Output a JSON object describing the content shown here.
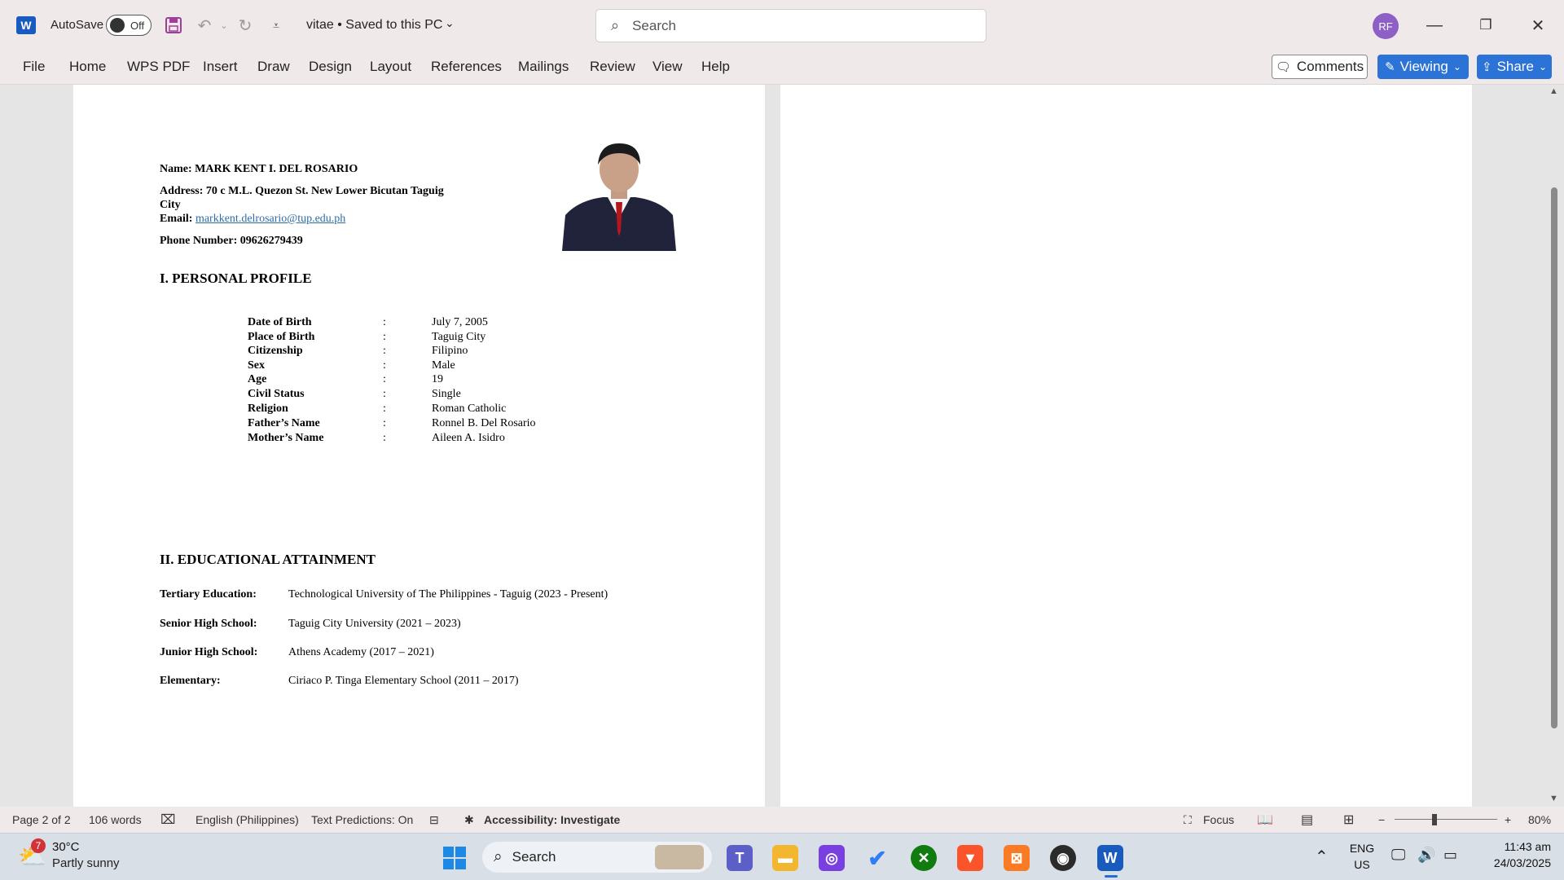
{
  "titlebar": {
    "app_logo": "W",
    "autosave_label": "AutoSave",
    "autosave_state": "Off",
    "document_title": "vitae • Saved to this PC",
    "search_placeholder": "Search",
    "avatar_initials": "RF"
  },
  "ribbon": {
    "tabs": [
      "File",
      "Home",
      "WPS PDF",
      "Insert",
      "Draw",
      "Design",
      "Layout",
      "References",
      "Mailings",
      "Review",
      "View",
      "Help"
    ],
    "comments_label": "Comments",
    "viewing_label": "Viewing",
    "share_label": "Share"
  },
  "document": {
    "name_line": "Name: MARK KENT I. DEL ROSARIO",
    "address_line1": "Address: 70 c M.L. Quezon St. New Lower Bicutan Taguig",
    "address_line2": "City",
    "email_label": "Email:",
    "email_value": "markkent.delrosario@tup.edu.ph",
    "phone_line": "Phone Number: 09626279439",
    "section1_title": "I. PERSONAL PROFILE",
    "personal_profile": [
      {
        "label": "Date of Birth",
        "value": "July 7, 2005"
      },
      {
        "label": "Place of Birth",
        "value": "Taguig City"
      },
      {
        "label": "Citizenship",
        "value": "Filipino"
      },
      {
        "label": "Sex",
        "value": "Male"
      },
      {
        "label": "Age",
        "value": "19"
      },
      {
        "label": "Civil Status",
        "value": "Single"
      },
      {
        "label": "Religion",
        "value": "Roman Catholic"
      },
      {
        "label": "Father’s Name",
        "value": "Ronnel B. Del Rosario"
      },
      {
        "label": "Mother’s Name",
        "value": "Aileen A. Isidro"
      }
    ],
    "colon": ":",
    "section2_title": "II. EDUCATIONAL ATTAINMENT",
    "education": [
      {
        "label": "Tertiary Education:",
        "value": "Technological University of The Philippines - Taguig  (2023 - Present)"
      },
      {
        "label": "Senior High School:",
        "value": "Taguig City University (2021 – 2023)"
      },
      {
        "label": "Junior High School:",
        "value": "Athens Academy (2017 – 2021)"
      },
      {
        "label": "Elementary:",
        "value": "Ciriaco P. Tinga Elementary School (2011 – 2017)"
      }
    ]
  },
  "statusbar": {
    "page": "Page 2 of 2",
    "words": "106 words",
    "language": "English (Philippines)",
    "text_predictions": "Text Predictions: On",
    "accessibility": "Accessibility: Investigate",
    "focus": "Focus",
    "zoom_minus": "−",
    "zoom_plus": "+",
    "zoom": "80%"
  },
  "taskbar": {
    "weather_badge": "7",
    "weather_temp": "30°C",
    "weather_desc": "Partly sunny",
    "search_label": "Search",
    "lang_line1": "ENG",
    "lang_line2": "US",
    "time": "11:43 am",
    "date": "24/03/2025"
  },
  "colors": {
    "chrome_bg": "#f0e9ea",
    "accent_blue": "#2b73d6",
    "word_blue": "#185abd",
    "link": "#2f6ca6"
  }
}
